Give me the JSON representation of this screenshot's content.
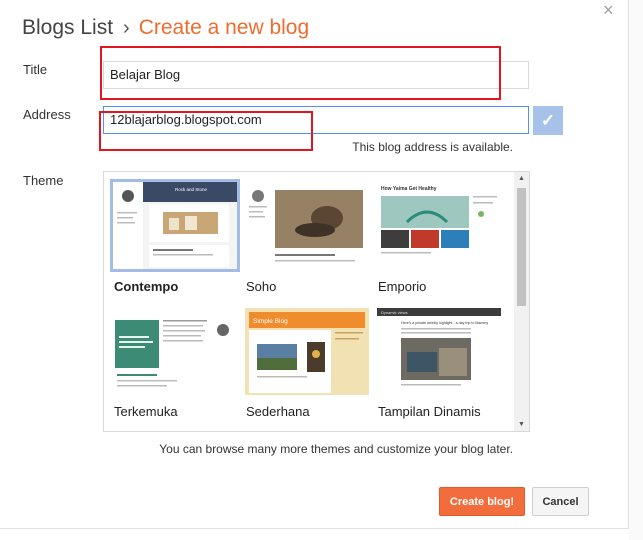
{
  "breadcrumb": {
    "root": "Blogs List",
    "separator": "›",
    "current": "Create a new blog"
  },
  "form": {
    "title_label": "Title",
    "title_value": "Belajar Blog",
    "address_label": "Address",
    "address_value": "12blajarblog.blogspot.com",
    "address_status": "This blog address is available.",
    "theme_label": "Theme"
  },
  "themes": [
    {
      "name": "Contempo",
      "selected": true
    },
    {
      "name": "Soho",
      "selected": false
    },
    {
      "name": "Emporio",
      "selected": false
    },
    {
      "name": "Terkemuka",
      "selected": false
    },
    {
      "name": "Sederhana",
      "selected": false
    },
    {
      "name": "Tampilan Dinamis",
      "selected": false
    }
  ],
  "thumb_text": {
    "contempo_title": "Rock and Stone",
    "emporio_title": "How Yaima Get Healthy",
    "sederhana_title": "Simple Blog",
    "dinamis_title": "Dynamic views",
    "dinamis_heading": "Here's a private weekly highlight - a day trip to Mammy"
  },
  "footer_text": "You can browse many more themes and customize your blog later.",
  "buttons": {
    "create": "Create blog!",
    "cancel": "Cancel"
  },
  "close_symbol": "×",
  "check_symbol": "✓",
  "accent_color": "#ef6c2f",
  "annotation_color": "#e2161d"
}
